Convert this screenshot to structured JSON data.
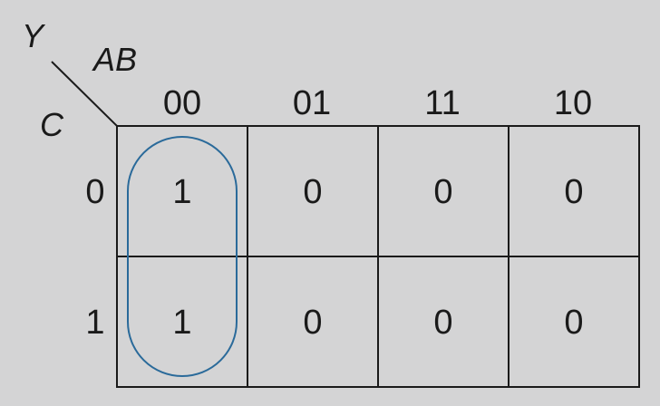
{
  "kmap": {
    "output_var": "Y",
    "col_vars": "AB",
    "row_vars": "C",
    "col_headers": [
      "00",
      "01",
      "11",
      "10"
    ],
    "row_headers": [
      "0",
      "1"
    ],
    "cells": [
      [
        "1",
        "0",
        "0",
        "0"
      ],
      [
        "1",
        "0",
        "0",
        "0"
      ]
    ],
    "group_color": "#2a6a9a"
  }
}
